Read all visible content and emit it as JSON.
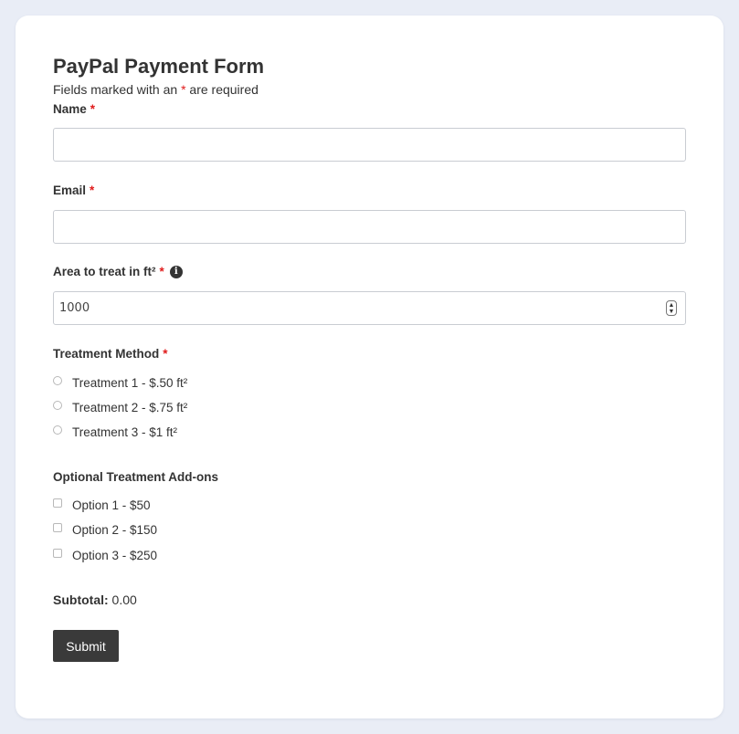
{
  "form": {
    "title": "PayPal Payment Form",
    "required_note_prefix": "Fields marked with an ",
    "required_star": "*",
    "required_note_suffix": " are required"
  },
  "fields": {
    "name": {
      "label": "Name",
      "value": "",
      "placeholder": ""
    },
    "email": {
      "label": "Email",
      "value": "",
      "placeholder": ""
    },
    "area": {
      "label": "Area to treat in ft²",
      "value": "1000",
      "info_icon": "info-icon"
    }
  },
  "treatment_method": {
    "label": "Treatment Method",
    "options": [
      {
        "label": "Treatment 1 - $.50 ft²",
        "selected": false
      },
      {
        "label": "Treatment 2 - $.75 ft²",
        "selected": false
      },
      {
        "label": "Treatment 3 - $1 ft²",
        "selected": false
      }
    ]
  },
  "addons": {
    "label": "Optional Treatment Add-ons",
    "options": [
      {
        "label": "Option 1 - $50",
        "checked": false
      },
      {
        "label": "Option 2 - $150",
        "checked": false
      },
      {
        "label": "Option 3 - $250",
        "checked": false
      }
    ]
  },
  "subtotal": {
    "label": "Subtotal:",
    "value": "0.00"
  },
  "submit_label": "Submit",
  "colors": {
    "background": "#e9edf6",
    "card": "#ffffff",
    "required": "#e01b1b",
    "button": "#3a3a3a"
  }
}
